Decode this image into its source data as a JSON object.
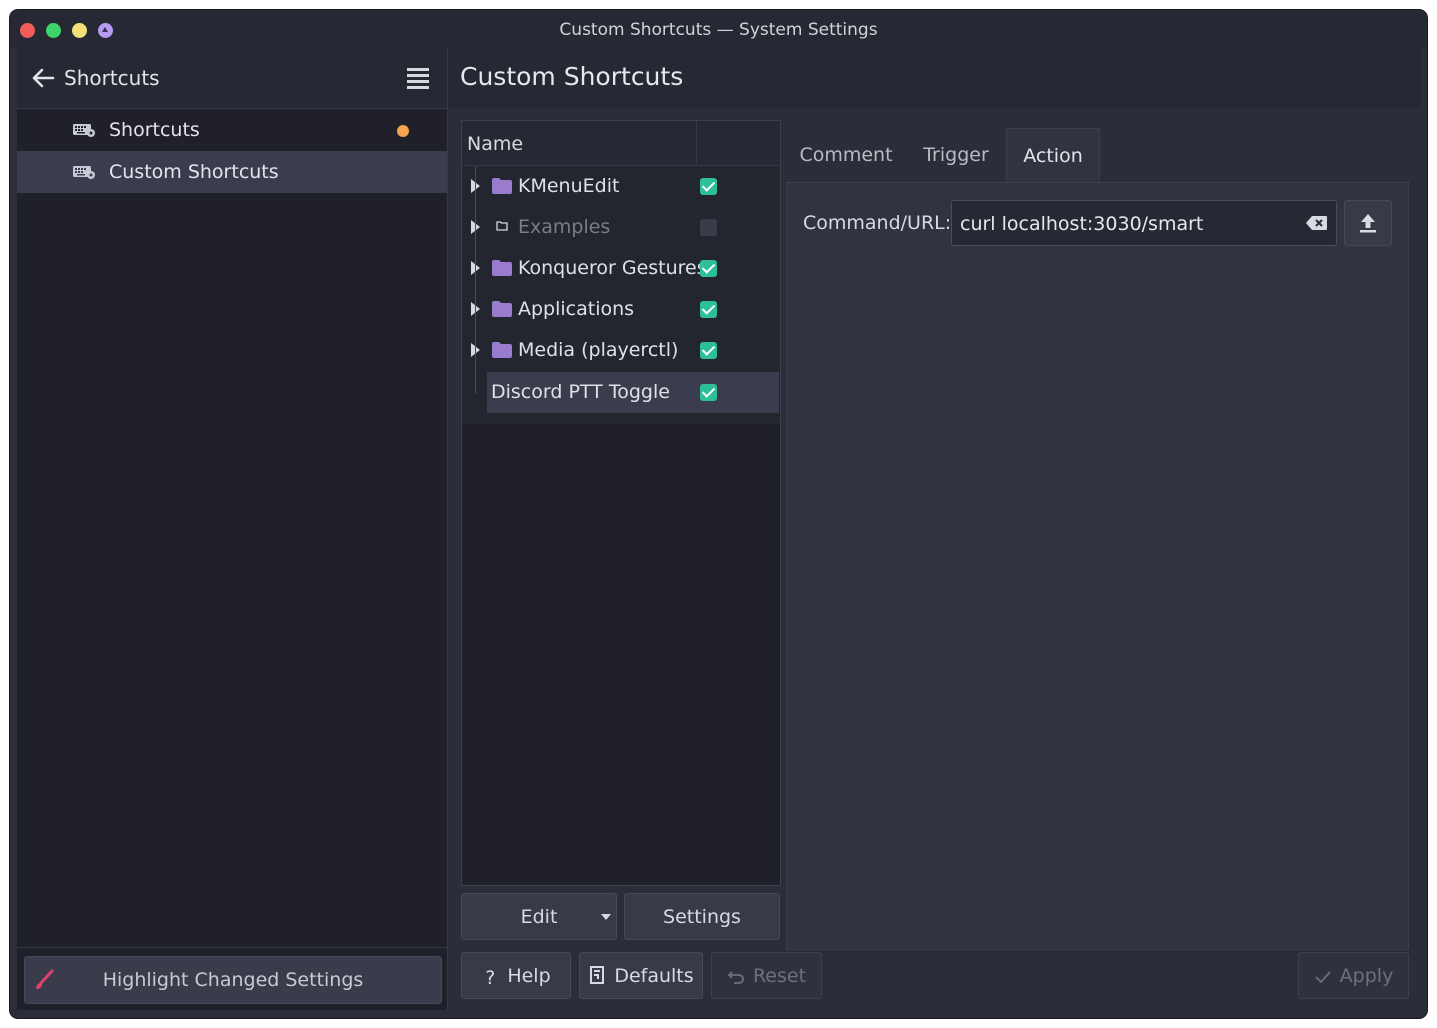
{
  "window": {
    "title": "Custom Shortcuts — System Settings"
  },
  "sidebar": {
    "title": "Shortcuts",
    "items": [
      {
        "label": "Shortcuts",
        "modified_dot": true
      },
      {
        "label": "Custom Shortcuts",
        "active": true
      }
    ],
    "footer_button": "Highlight Changed Settings"
  },
  "main": {
    "title": "Custom Shortcuts",
    "tree": {
      "header": "Name",
      "rows": [
        {
          "label": "KMenuEdit",
          "checked": true
        },
        {
          "label": "Examples",
          "checked": false,
          "disabled": true
        },
        {
          "label": "Konqueror Gestures",
          "checked": true
        },
        {
          "label": "Applications",
          "checked": true
        },
        {
          "label": "Media (playerctl)",
          "checked": true
        },
        {
          "label": "Discord PTT Toggle",
          "checked": true,
          "selected": true
        }
      ]
    },
    "edit_button": "Edit",
    "settings_button": "Settings",
    "tabs": [
      "Comment",
      "Trigger",
      "Action"
    ],
    "active_tab": "Action",
    "action": {
      "command_label": "Command/URL:",
      "command_value": "curl localhost:3030/smart"
    }
  },
  "footer": {
    "help": "Help",
    "defaults": "Defaults",
    "reset": "Reset",
    "apply": "Apply"
  },
  "colors": {
    "accent_check": "#2dbf97",
    "folder": "#9a7ccf",
    "modified_dot": "#f6a354",
    "highlight_brush": "#e0406e"
  }
}
